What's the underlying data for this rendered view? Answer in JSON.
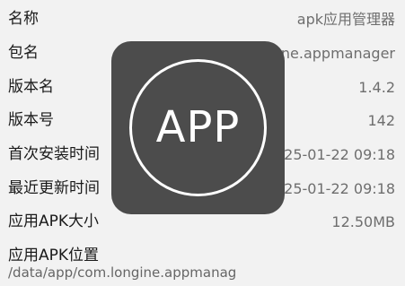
{
  "rows": [
    {
      "label": "名称",
      "value": "apk应用管理器"
    },
    {
      "label": "包名",
      "value": "com.longine.appmanager"
    },
    {
      "label": "版本名",
      "value": "1.4.2"
    },
    {
      "label": "版本号",
      "value": "142"
    },
    {
      "label": "首次安装时间",
      "value": "2025-01-22 09:18"
    },
    {
      "label": "最近更新时间",
      "value": "2025-01-22 09:18"
    },
    {
      "label": "应用APK大小",
      "value": "12.50MB"
    }
  ],
  "apk_location": {
    "label": "应用APK位置",
    "value": "/data/app/com.longine.appmanag"
  },
  "app_icon": {
    "icon": "app-placeholder-icon",
    "text": "APP",
    "background": "#4c4c4c",
    "foreground": "#ffffff"
  }
}
